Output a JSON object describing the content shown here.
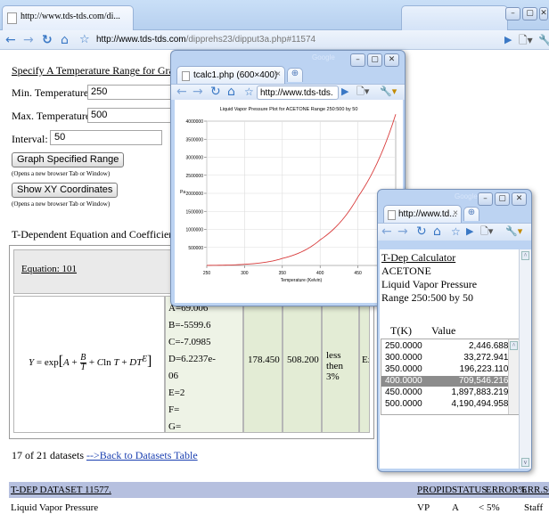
{
  "main_browser": {
    "tab_title": "http://www.tds-tds.com/di...",
    "url_host": "http://www.tds-tds.com",
    "url_path": "/dipprehs23/dipput3a.php#11574"
  },
  "form": {
    "heading": "Specify A Temperature Range for Graphing",
    "min_label": "Min. Temperature(K):",
    "min_value": "250",
    "max_label": "Max. Temperature(K):",
    "max_value": "500",
    "interval_label": "Interval:",
    "interval_value": "50",
    "graph_button": "Graph Specified Range",
    "graph_note": "(Opens a new browser Tab or Window)",
    "xy_button": "Show XY Coordinates",
    "xy_note": "(Opens a new browser Tab or Window)"
  },
  "coef_section": {
    "heading": "T-Dependent Equation and Coefficients for Data",
    "equation_link": "Equation: 101",
    "coefficients": [
      "A=69.006",
      "B=-5599.6",
      "C=-7.0985",
      "D=6.2237e-",
      "06",
      "E=2",
      "F=",
      "G="
    ],
    "tmin": "178.450",
    "tmax": "508.200",
    "error": "less then 3%",
    "partial_col": "Exp"
  },
  "footer": {
    "datasets_text": "17 of 21 datasets",
    "back_link": "-->Back to Datasets Table",
    "dataset_header": "T-DEP DATASET 11577.",
    "columns": [
      "PROPID",
      "STATUS",
      "ERROR%",
      "ERR.SO"
    ],
    "row_name": "Liquid Vapor Pressure",
    "row_values": [
      "VP",
      "A",
      "< 5%",
      "Staff"
    ]
  },
  "chart_popup": {
    "tab_title": "tcalc1.php (600×400)",
    "url": "http://www.tds-tds.",
    "google": "Google"
  },
  "chart_data": {
    "type": "line",
    "title": "Liquid Vapor Pressure Plot for ACETONE Range 250:500 by 50",
    "xlabel": "Temperature (Kelvin)",
    "ylabel": "Pa",
    "x": [
      250,
      300,
      350,
      400,
      450,
      500
    ],
    "series": [
      {
        "values": [
          2446.6889,
          33272.9412,
          196223.1106,
          709546.216,
          1897883.2197,
          4190494.9581
        ]
      }
    ],
    "xlim": [
      250,
      500
    ],
    "ylim": [
      0,
      4000000
    ],
    "x_ticks": [
      "250",
      "300",
      "350",
      "400",
      "450"
    ],
    "y_ticks": [
      "500000",
      "1000000",
      "1500000",
      "2000000",
      "2500000",
      "3000000",
      "3500000",
      "4000000"
    ],
    "grid": true,
    "line_color": "#d83a3a"
  },
  "calc_popup": {
    "tab_title": "http://www.td...",
    "google": "Google",
    "title_link": "T-Dep Calculator",
    "compound": "ACETONE",
    "property": "Liquid Vapor Pressure",
    "range": "Range 250:500 by 50",
    "col_t": "T(K)",
    "col_value": "Value",
    "rows": [
      {
        "t": "250.0000",
        "v": "2,446.6889"
      },
      {
        "t": "300.0000",
        "v": "33,272.9412"
      },
      {
        "t": "350.0000",
        "v": "196,223.1106"
      },
      {
        "t": "400.0000",
        "v": "709,546.2160"
      },
      {
        "t": "450.0000",
        "v": "1,897,883.2197"
      },
      {
        "t": "500.0000",
        "v": "4,190,494.9581"
      }
    ],
    "selected_index": 3
  }
}
